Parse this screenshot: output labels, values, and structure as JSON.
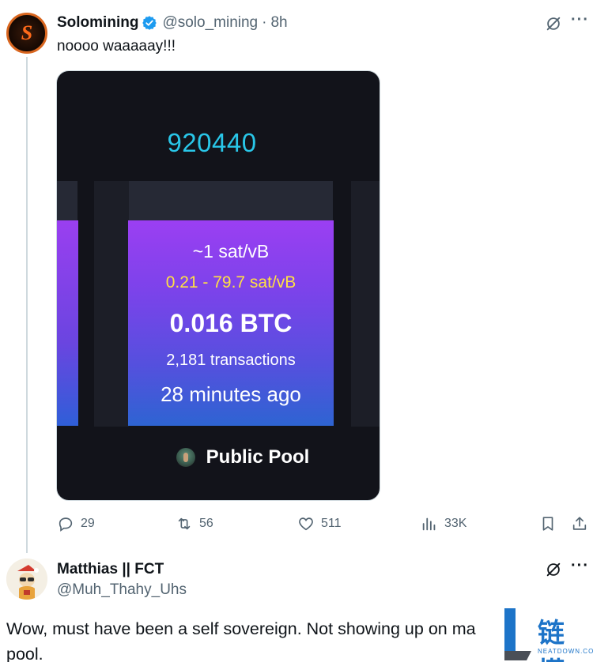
{
  "tweet": {
    "author_name": "Solomining",
    "handle": "@solo_mining",
    "separator": "·",
    "time": "8h",
    "text": "noooo waaaaay!!!",
    "avatar_letter": "S"
  },
  "media": {
    "block_height": "920440",
    "median_fee": "~1 sat/vB",
    "fee_range": "0.21 - 79.7 sat/vB",
    "total_fees": "0.016 BTC",
    "transactions": "2,181 transactions",
    "mined_ago": "28 minutes ago",
    "pool_name": "Public Pool"
  },
  "actions": {
    "replies": "29",
    "reposts": "56",
    "likes": "511",
    "views": "33K"
  },
  "reply": {
    "author_name": "Matthias || FCT",
    "handle": "@Muh_Thahy_Uhs",
    "text": "Wow, must have been a self sovereign. Not showing up on ma pool."
  },
  "watermark": {
    "cn": "链懂",
    "en": "NEATDOWN.COM"
  },
  "colors": {
    "block_height": "#29c6e8",
    "fee_range": "#ffe043",
    "verified_badge": "#1d9bf0",
    "muted_text": "#536471"
  }
}
